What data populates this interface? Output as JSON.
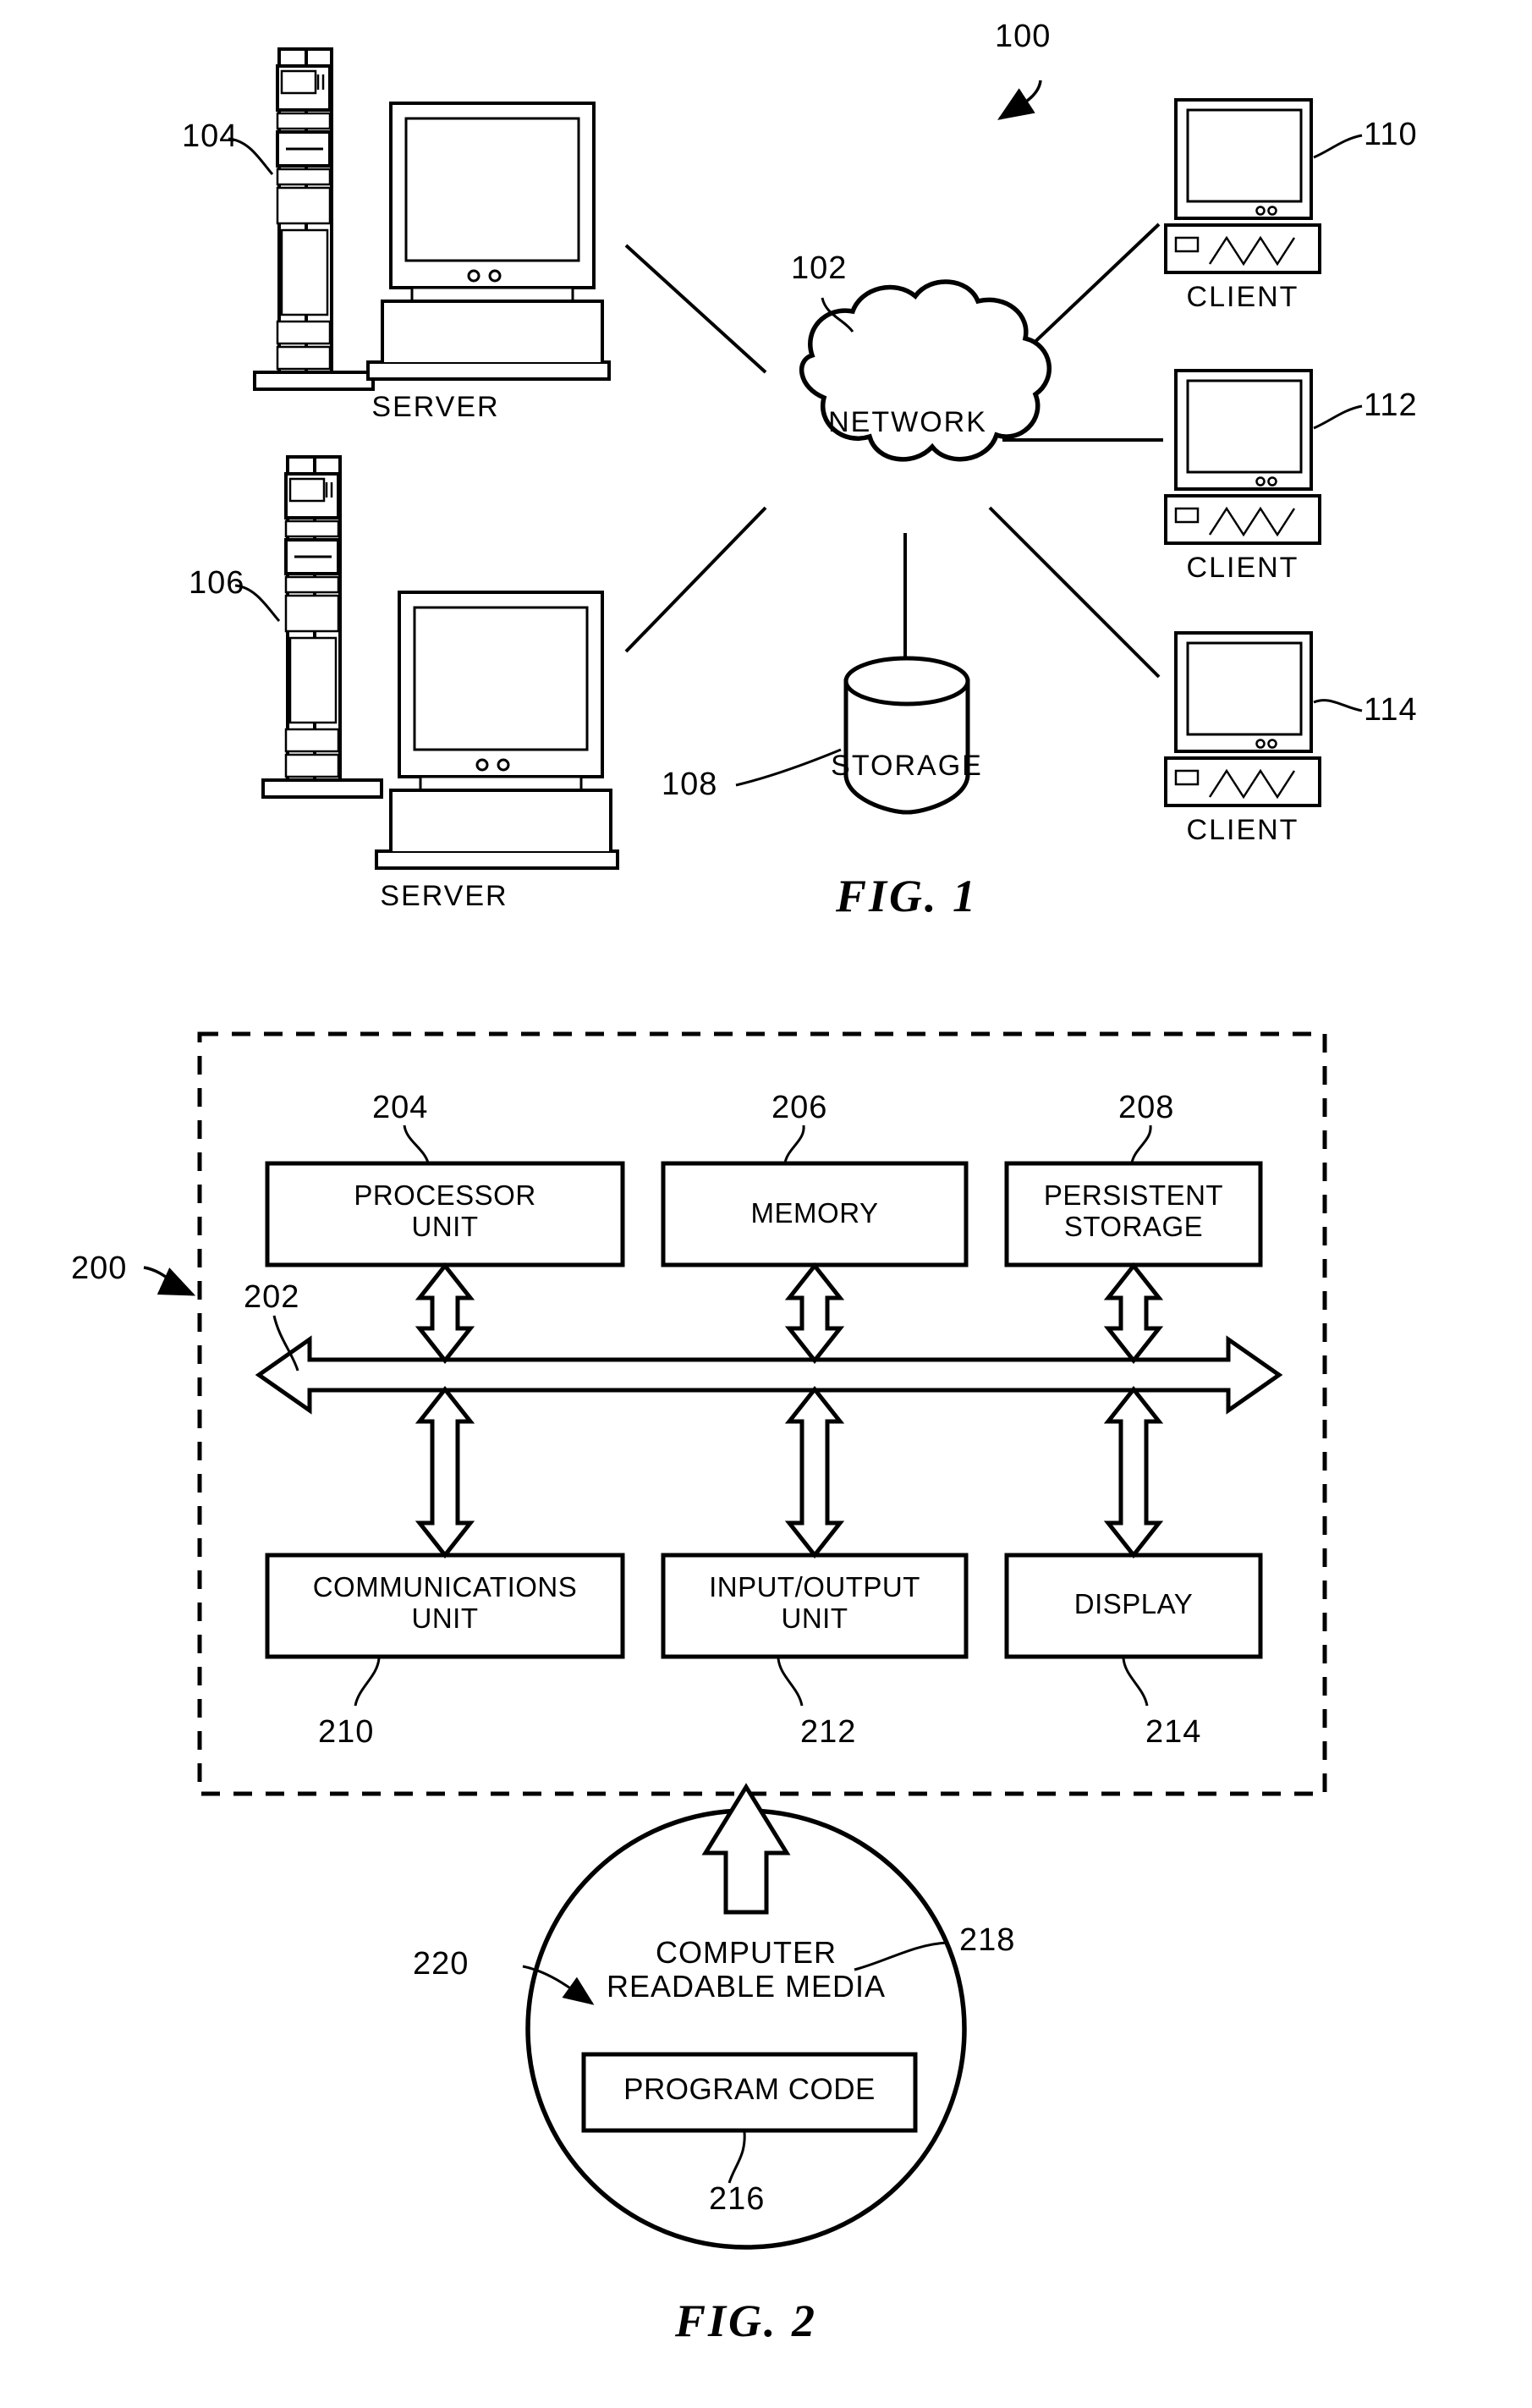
{
  "figure1": {
    "ref": "100",
    "caption": "FIG. 1",
    "network": {
      "ref": "102",
      "label": "NETWORK"
    },
    "storage": {
      "ref": "108",
      "label": "STORAGE"
    },
    "servers": [
      {
        "ref": "104",
        "label": "SERVER"
      },
      {
        "ref": "106",
        "label": "SERVER"
      }
    ],
    "clients": [
      {
        "ref": "110",
        "label": "CLIENT"
      },
      {
        "ref": "112",
        "label": "CLIENT"
      },
      {
        "ref": "114",
        "label": "CLIENT"
      }
    ]
  },
  "figure2": {
    "ref": "200",
    "caption": "FIG. 2",
    "bus": {
      "ref": "202"
    },
    "top_row": [
      {
        "ref": "204",
        "label": "PROCESSOR\nUNIT",
        "line1": "PROCESSOR",
        "line2": "UNIT"
      },
      {
        "ref": "206",
        "label": "MEMORY",
        "line1": "MEMORY",
        "line2": ""
      },
      {
        "ref": "208",
        "label": "PERSISTENT\nSTORAGE",
        "line1": "PERSISTENT",
        "line2": "STORAGE"
      }
    ],
    "bottom_row": [
      {
        "ref": "210",
        "label": "COMMUNICATIONS\nUNIT",
        "line1": "COMMUNICATIONS",
        "line2": "UNIT"
      },
      {
        "ref": "212",
        "label": "INPUT/OUTPUT\nUNIT",
        "line1": "INPUT/OUTPUT",
        "line2": "UNIT"
      },
      {
        "ref": "214",
        "label": "DISPLAY",
        "line1": "DISPLAY",
        "line2": ""
      }
    ],
    "media": {
      "ref": "218",
      "pointer_ref": "220",
      "line1": "COMPUTER",
      "line2": "READABLE MEDIA",
      "program_code": {
        "ref": "216",
        "label": "PROGRAM CODE"
      }
    }
  },
  "colors": {
    "ink": "#000000",
    "paper": "#ffffff"
  }
}
